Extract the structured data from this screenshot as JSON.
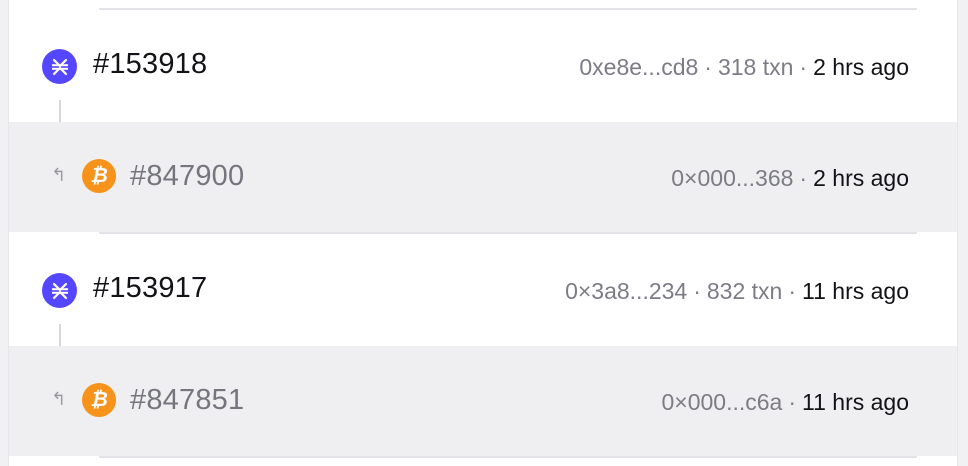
{
  "blocks": [
    {
      "stacks": {
        "height": "#153918",
        "hash": "0xe8e...cd8",
        "txns": "318 txn",
        "time": "2 hrs ago"
      },
      "bitcoin": {
        "height": "#847900",
        "hash": "0×000...368",
        "time": "2 hrs ago"
      }
    },
    {
      "stacks": {
        "height": "#153917",
        "hash": "0×3a8...234",
        "txns": "832 txn",
        "time": "11 hrs ago"
      },
      "bitcoin": {
        "height": "#847851",
        "hash": "0×000...c6a",
        "time": "11 hrs ago"
      }
    }
  ],
  "separator": "·",
  "icons": {
    "stacks": "stacks-icon",
    "bitcoin": "bitcoin-icon",
    "bitcoin_glyph": "₿",
    "anchor": "anchor-arrow-icon",
    "anchor_glyph": "↰"
  },
  "colors": {
    "stacks": "#5546ff",
    "bitcoin": "#f7931a",
    "sub_row_bg": "#efeff1"
  }
}
